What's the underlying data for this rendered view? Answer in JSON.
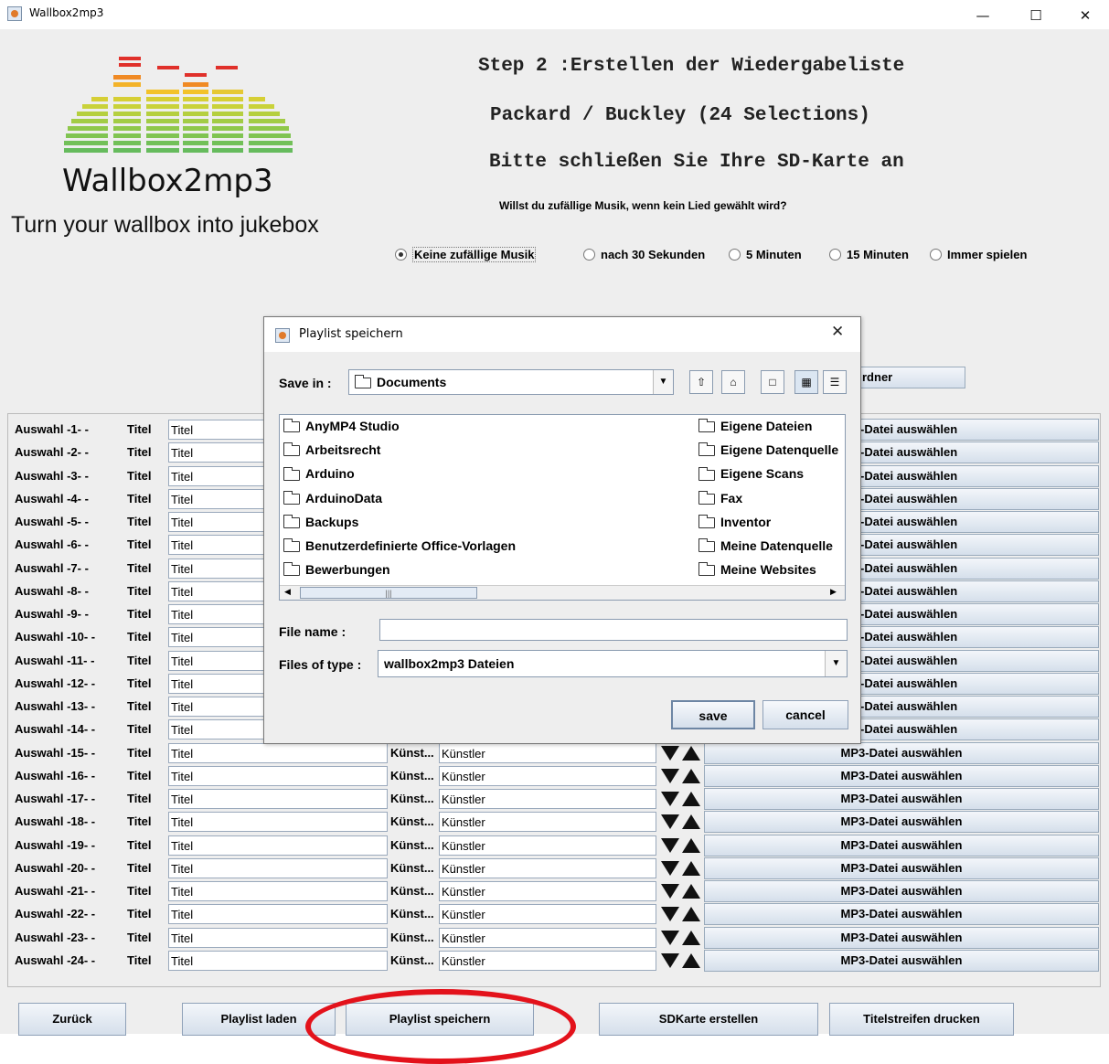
{
  "window": {
    "title": "Wallbox2mp3",
    "minimize": "—",
    "maximize": "☐",
    "close": "✕"
  },
  "logo": {
    "name": "Wallbox2mp3",
    "slogan": "Turn your wallbox into jukebox"
  },
  "header": {
    "step_title": "Step 2 :Erstellen der Wiedergabeliste",
    "playlist_name": "Packard / Buckley (24 Selections)",
    "sd_message": "Bitte schließen Sie Ihre SD-Karte an",
    "random_question": "Willst du zufällige Musik, wenn kein Lied gewählt wird?"
  },
  "random_options": [
    {
      "label": "Keine zufällige Musik",
      "selected": true
    },
    {
      "label": "nach 30 Sekunden",
      "selected": false
    },
    {
      "label": "5 Minuten",
      "selected": false
    },
    {
      "label": "15 Minuten",
      "selected": false
    },
    {
      "label": "Immer spielen",
      "selected": false
    }
  ],
  "partial_button": "rdner",
  "table": {
    "titel_label": "Titel",
    "titel_placeholder": "Titel",
    "kuenstler_label": "Künst...",
    "kuenstler_placeholder": "Künstler",
    "mp3_button": "MP3-Datei auswählen",
    "mp3_button_partial": "-Datei auswählen",
    "rows": [
      "Auswahl -1- -",
      "Auswahl -2- -",
      "Auswahl -3- -",
      "Auswahl -4- -",
      "Auswahl -5- -",
      "Auswahl -6- -",
      "Auswahl -7- -",
      "Auswahl -8- -",
      "Auswahl -9- -",
      "Auswahl -10- -",
      "Auswahl -11- -",
      "Auswahl -12- -",
      "Auswahl -13- -",
      "Auswahl -14- -",
      "Auswahl -15- -",
      "Auswahl -16- -",
      "Auswahl -17- -",
      "Auswahl -18- -",
      "Auswahl -19- -",
      "Auswahl -20- -",
      "Auswahl -21- -",
      "Auswahl -22- -",
      "Auswahl -23- -",
      "Auswahl -24- -"
    ]
  },
  "bottom_buttons": {
    "back": "Zurück",
    "load": "Playlist laden",
    "save": "Playlist speichern",
    "sd": "SDKarte erstellen",
    "print": "Titelstreifen drucken"
  },
  "dialog": {
    "title": "Playlist speichern",
    "close": "✕",
    "save_in_label": "Save in :",
    "save_in_value": "Documents",
    "files_left": [
      "AnyMP4 Studio",
      "Arbeitsrecht",
      "Arduino",
      "ArduinoData",
      "Backups",
      "Benutzerdefinierte Office-Vorlagen",
      "Bewerbungen"
    ],
    "files_right": [
      "Eigene Dateien",
      "Eigene Datenquelle",
      "Eigene Scans",
      "Fax",
      "Inventor",
      "Meine Datenquelle",
      "Meine Websites"
    ],
    "file_name_label": "File name :",
    "file_name_value": "",
    "file_type_label": "Files of type :",
    "file_type_value": "wallbox2mp3 Dateien",
    "save_button": "save",
    "cancel_button": "cancel"
  }
}
